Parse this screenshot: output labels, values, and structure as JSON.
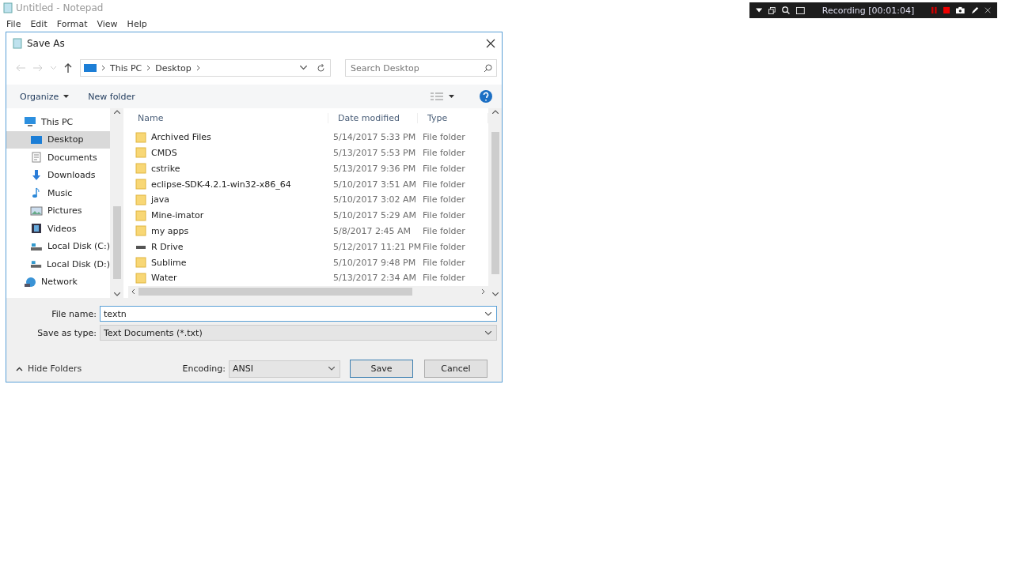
{
  "notepad": {
    "title": "Untitled - Notepad",
    "menu": [
      "File",
      "Edit",
      "Format",
      "View",
      "Help"
    ]
  },
  "recorder": {
    "status": "Recording [00:01:04]"
  },
  "dialog": {
    "title": "Save As",
    "path": [
      "This PC",
      "Desktop"
    ],
    "search": {
      "placeholder": "Search Desktop"
    },
    "toolbar": {
      "organize": "Organize",
      "new_folder": "New folder"
    },
    "nav": [
      {
        "label": "This PC",
        "kind": "pc",
        "selected": false,
        "children": [
          {
            "label": "Desktop",
            "kind": "desktop",
            "selected": true
          },
          {
            "label": "Documents",
            "kind": "documents",
            "selected": false
          },
          {
            "label": "Downloads",
            "kind": "downloads",
            "selected": false
          },
          {
            "label": "Music",
            "kind": "music",
            "selected": false
          },
          {
            "label": "Pictures",
            "kind": "pictures",
            "selected": false
          },
          {
            "label": "Videos",
            "kind": "videos",
            "selected": false
          },
          {
            "label": "Local Disk (C:)",
            "kind": "disk",
            "selected": false
          },
          {
            "label": "Local Disk (D:)",
            "kind": "disk",
            "selected": false
          }
        ]
      },
      {
        "label": "Network",
        "kind": "network",
        "selected": false
      }
    ],
    "columns": [
      "Name",
      "Date modified",
      "Type"
    ],
    "rows": [
      {
        "name": "Archived Files",
        "date": "5/14/2017 5:33 PM",
        "type": "File folder",
        "kind": "folder"
      },
      {
        "name": "CMDS",
        "date": "5/13/2017 5:53 PM",
        "type": "File folder",
        "kind": "folder"
      },
      {
        "name": "cstrike",
        "date": "5/13/2017 9:36 PM",
        "type": "File folder",
        "kind": "folder"
      },
      {
        "name": "eclipse-SDK-4.2.1-win32-x86_64",
        "date": "5/10/2017 3:51 AM",
        "type": "File folder",
        "kind": "folder"
      },
      {
        "name": "java",
        "date": "5/10/2017 3:02 AM",
        "type": "File folder",
        "kind": "folder"
      },
      {
        "name": "Mine-imator",
        "date": "5/10/2017 5:29 AM",
        "type": "File folder",
        "kind": "folder"
      },
      {
        "name": "my apps",
        "date": "5/8/2017 2:45 AM",
        "type": "File folder",
        "kind": "folder"
      },
      {
        "name": "R Drive",
        "date": "5/12/2017 11:21 PM",
        "type": "File folder",
        "kind": "drive"
      },
      {
        "name": "Sublime",
        "date": "5/10/2017 9:48 PM",
        "type": "File folder",
        "kind": "folder"
      },
      {
        "name": "Water",
        "date": "5/13/2017 2:34 AM",
        "type": "File folder",
        "kind": "folder"
      }
    ],
    "file_name": {
      "label": "File name:",
      "value": "textn"
    },
    "save_type": {
      "label": "Save as type:",
      "value": "Text Documents (*.txt)"
    },
    "hide_folders": "Hide Folders",
    "encoding": {
      "label": "Encoding:",
      "value": "ANSI"
    },
    "buttons": [
      "Save",
      "Cancel"
    ]
  }
}
